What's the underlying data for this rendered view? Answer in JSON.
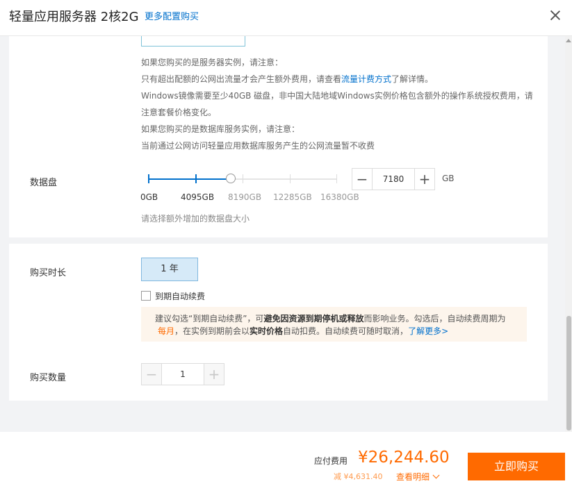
{
  "header": {
    "title": "轻量应用服务器 2核2G",
    "more_config_link": "更多配置购买"
  },
  "notes": {
    "server_heading": "如果您购买的是服务器实例，请注意：",
    "traffic_before": "只有超出配额的公网出流量才会产生额外费用，请查看",
    "traffic_link": "流量计费方式",
    "traffic_after": "了解详情。",
    "windows_line1": "Windows镜像需要至少40GB 磁盘，非中国大陆地域Windows实例价格包含额外的操作系统授权费用，请",
    "windows_line2": "注意套餐价格变化。",
    "db_heading": "如果您购买的是数据库服务实例，请注意：",
    "db_line": "当前通过公网访问轻量应用数据库服务产生的公网流量暂不收费"
  },
  "data_disk": {
    "label": "数据盘",
    "tick_labels": [
      "0GB",
      "4095GB",
      "8190GB",
      "12285GB",
      "16380GB"
    ],
    "slider_max": 16380,
    "value": "7180",
    "unit": "GB",
    "hint": "请选择额外增加的数据盘大小"
  },
  "duration": {
    "label": "购买时长",
    "selected": "1 年",
    "auto_renew_label": "到期自动续费"
  },
  "tip": {
    "t1": "建议勾选“到期自动续费”，可",
    "t2": "避免因资源到期停机或释放",
    "t3": "而影响业务。勾选后，自动续费周期为",
    "t4": "每月",
    "t5": "，在实例到期前会以",
    "t6": "实时价格",
    "t7": "自动扣费。自动续费可随时取消，",
    "t8": "了解更多>"
  },
  "quantity": {
    "label": "购买数量",
    "value": "1"
  },
  "footer": {
    "fee_label": "应付费用",
    "price": "¥26,244.60",
    "discount": "减 ¥4,631.40",
    "detail": "查看明细",
    "buy_button": "立即购买"
  },
  "colors": {
    "accent": "#ff6a00",
    "link": "#0070cc",
    "selected_bg": "#d6eaf8"
  }
}
